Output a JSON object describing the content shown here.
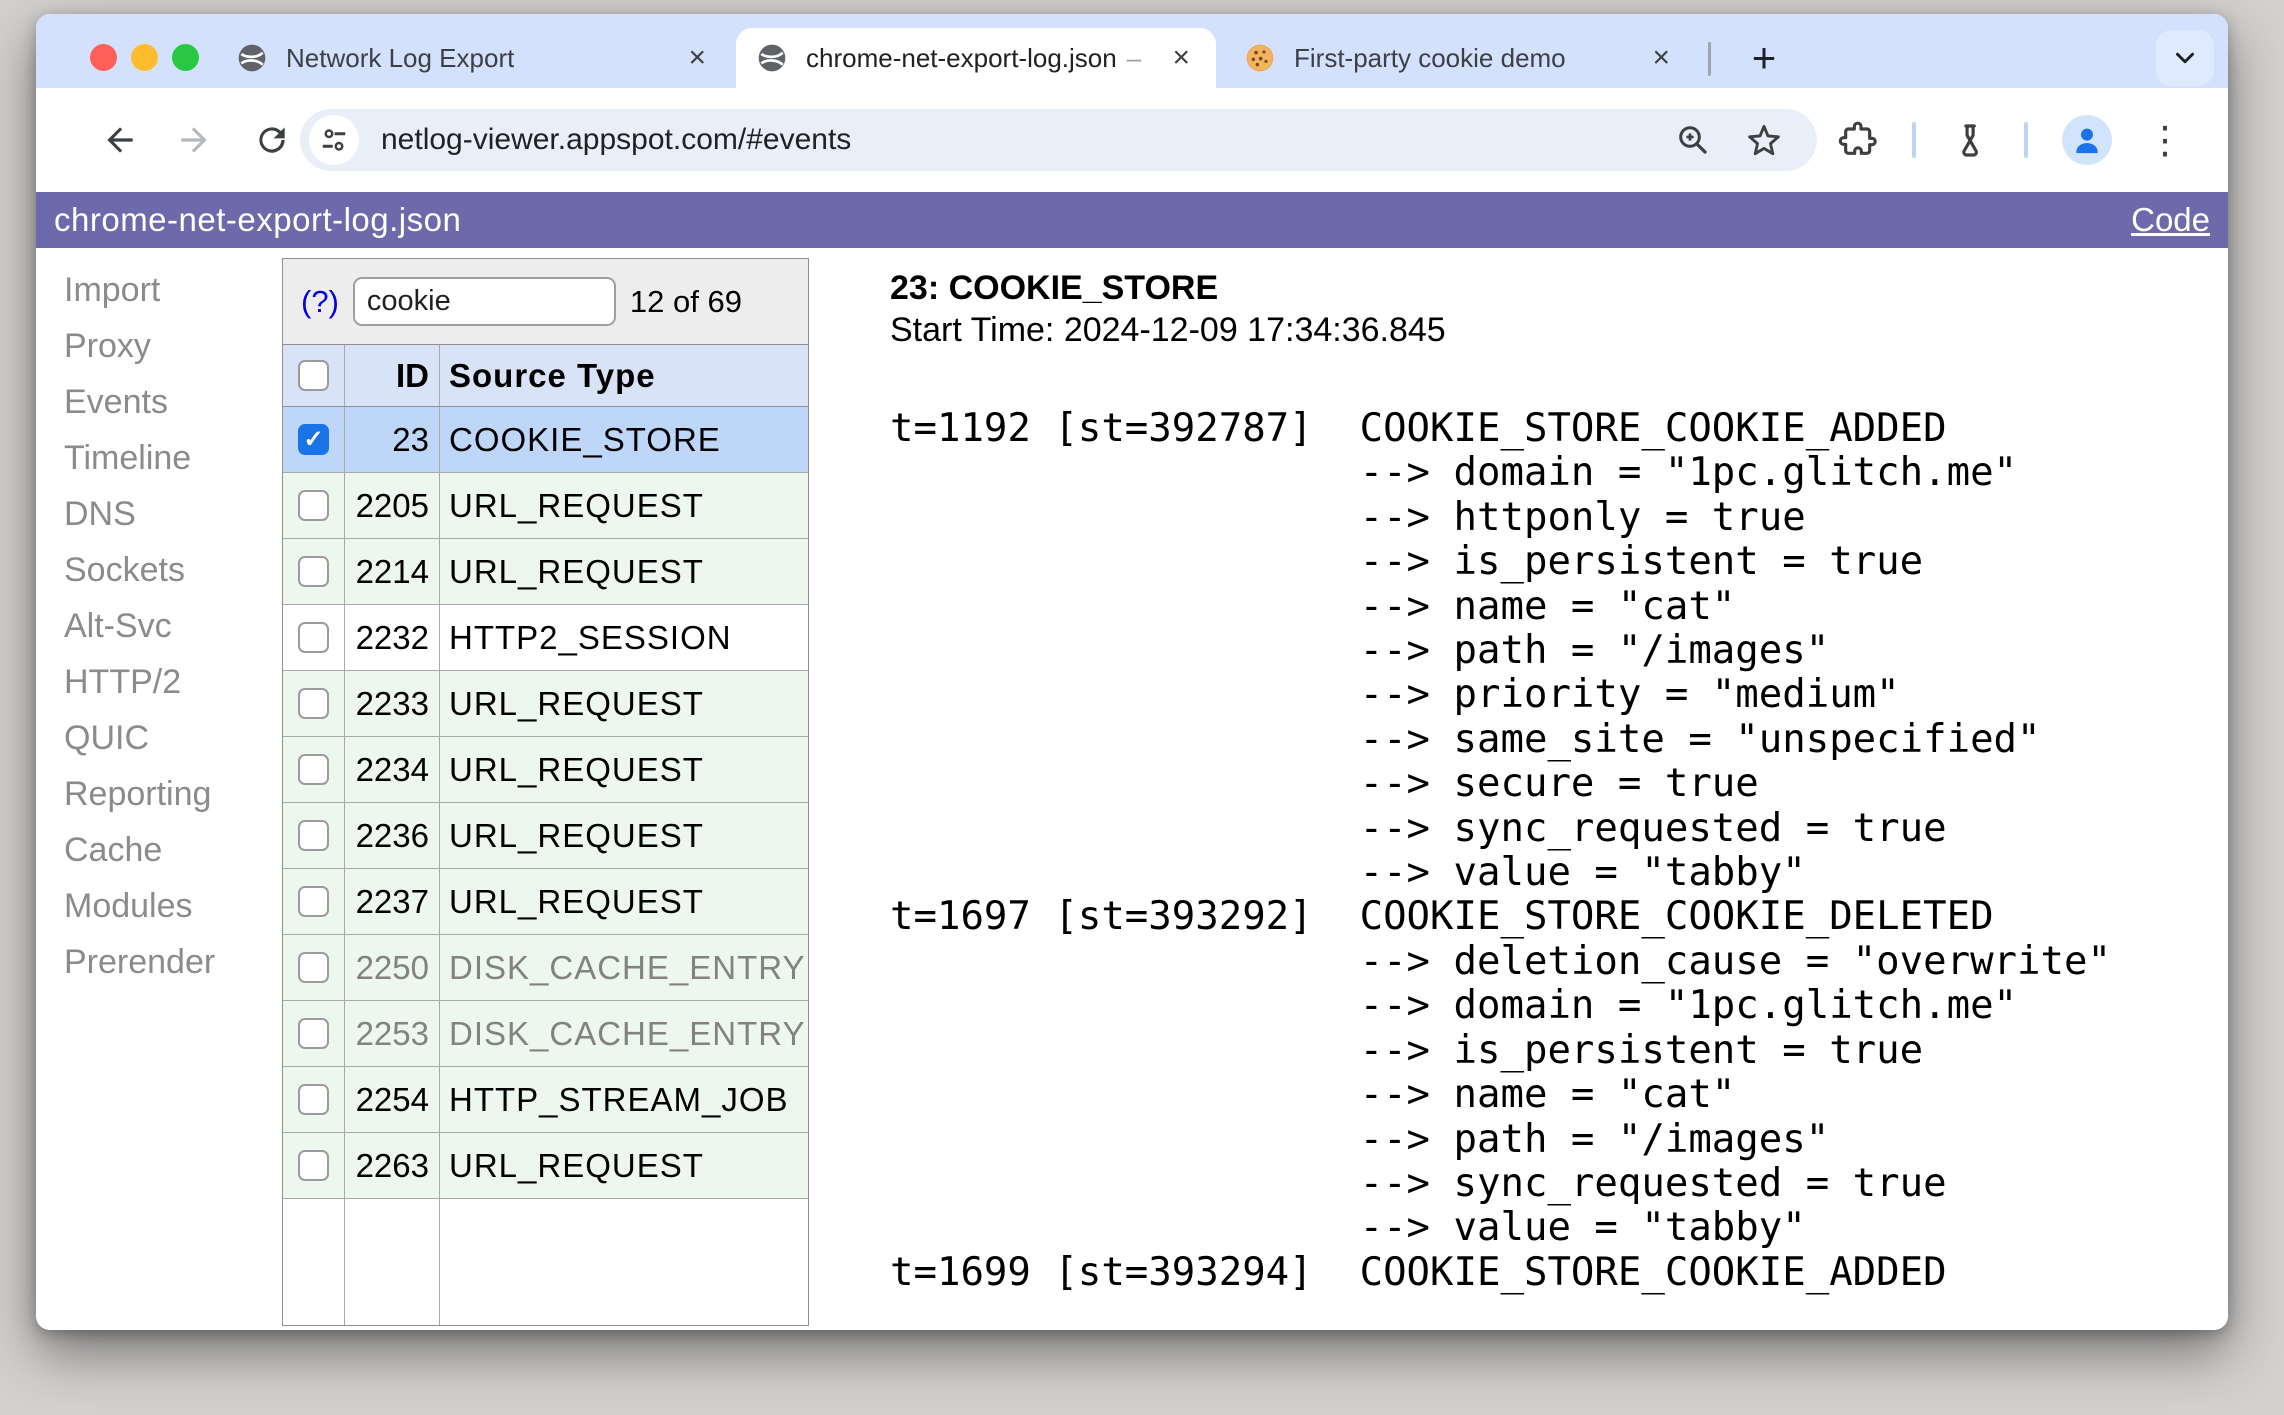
{
  "colors": {
    "accent_purple": "#6c6aaa",
    "tabstrip_bg": "#d3e1fc",
    "omnibox_bg": "#e9eef8",
    "selected_row_bg": "#bed6f8",
    "header_row_bg": "#d9e3f8",
    "active_row_bg": "#ecf8ee",
    "checkbox_checked": "#1a73e8",
    "link_blue": "#0202e0",
    "traffic_red": "#ff5f57",
    "traffic_yellow": "#febc2e",
    "traffic_green": "#28c840"
  },
  "browser": {
    "tabs": [
      {
        "title": "Network Log Export",
        "favicon": "globe-icon",
        "close": "×"
      },
      {
        "title": "chrome-net-export-log.json",
        "suffix": "–",
        "favicon": "globe-icon",
        "close": "×",
        "active": true
      },
      {
        "title": "First-party cookie demo",
        "favicon": "cookie-icon",
        "close": "×"
      }
    ],
    "new_tab_label": "+",
    "url": "netlog-viewer.appspot.com/#events",
    "menu_dots": "⋮"
  },
  "header": {
    "title": "chrome-net-export-log.json",
    "code_link": "Code"
  },
  "sidebar": {
    "items": [
      "Import",
      "Proxy",
      "Events",
      "Timeline",
      "DNS",
      "Sockets",
      "Alt-Svc",
      "HTTP/2",
      "QUIC",
      "Reporting",
      "Cache",
      "Modules",
      "Prerender"
    ]
  },
  "filter": {
    "help": "(?)",
    "value": "cookie",
    "count": "12 of 69",
    "check_glyph": "✓"
  },
  "table": {
    "columns": [
      "ID",
      "Source Type"
    ],
    "rows": [
      {
        "id": "23",
        "type": "COOKIE_STORE",
        "checked": true,
        "state": "sel"
      },
      {
        "id": "2205",
        "type": "URL_REQUEST",
        "checked": false,
        "state": "green"
      },
      {
        "id": "2214",
        "type": "URL_REQUEST",
        "checked": false,
        "state": "green"
      },
      {
        "id": "2232",
        "type": "HTTP2_SESSION",
        "checked": false,
        "state": "white"
      },
      {
        "id": "2233",
        "type": "URL_REQUEST",
        "checked": false,
        "state": "green"
      },
      {
        "id": "2234",
        "type": "URL_REQUEST",
        "checked": false,
        "state": "green"
      },
      {
        "id": "2236",
        "type": "URL_REQUEST",
        "checked": false,
        "state": "green"
      },
      {
        "id": "2237",
        "type": "URL_REQUEST",
        "checked": false,
        "state": "green"
      },
      {
        "id": "2250",
        "type": "DISK_CACHE_ENTRY",
        "checked": false,
        "state": "green",
        "dimmed": true
      },
      {
        "id": "2253",
        "type": "DISK_CACHE_ENTRY",
        "checked": false,
        "state": "green",
        "dimmed": true
      },
      {
        "id": "2254",
        "type": "HTTP_STREAM_JOB",
        "checked": false,
        "state": "green"
      },
      {
        "id": "2263",
        "type": "URL_REQUEST",
        "checked": false,
        "state": "green"
      }
    ]
  },
  "detail": {
    "title": "23: COOKIE_STORE",
    "start_time": "Start Time: 2024-12-09 17:34:36.845",
    "events": [
      {
        "t": "1192",
        "st": "392787",
        "type": "COOKIE_STORE_COOKIE_ADDED",
        "params": [
          "domain = \"1pc.glitch.me\"",
          "httponly = true",
          "is_persistent = true",
          "name = \"cat\"",
          "path = \"/images\"",
          "priority = \"medium\"",
          "same_site = \"unspecified\"",
          "secure = true",
          "sync_requested = true",
          "value = \"tabby\""
        ]
      },
      {
        "t": "1697",
        "st": "393292",
        "type": "COOKIE_STORE_COOKIE_DELETED",
        "params": [
          "deletion_cause = \"overwrite\"",
          "domain = \"1pc.glitch.me\"",
          "is_persistent = true",
          "name = \"cat\"",
          "path = \"/images\"",
          "sync_requested = true",
          "value = \"tabby\""
        ]
      },
      {
        "t": "1699",
        "st": "393294",
        "type": "COOKIE_STORE_COOKIE_ADDED",
        "params": []
      }
    ]
  }
}
